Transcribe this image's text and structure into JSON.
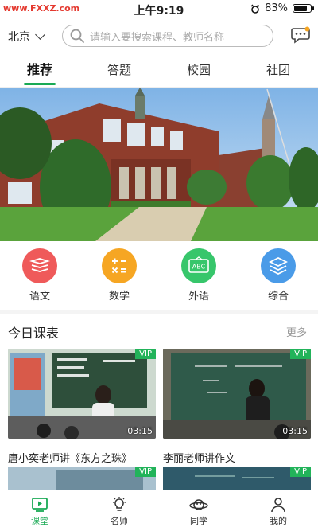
{
  "status_bar": {
    "watermark": "www.FXXZ.com",
    "time": "上午9:19",
    "battery": "83%",
    "battery_level": 0.83
  },
  "header": {
    "city": "北京",
    "search_placeholder": "请输入要搜索课程、教师名称"
  },
  "tabs": [
    {
      "label": "推荐",
      "active": true
    },
    {
      "label": "答题",
      "active": false
    },
    {
      "label": "校园",
      "active": false
    },
    {
      "label": "社团",
      "active": false
    }
  ],
  "categories": [
    {
      "label": "语文",
      "color": "#ef5a5a",
      "icon": "book-stack-icon"
    },
    {
      "label": "数学",
      "color": "#f6a623",
      "icon": "math-operators-icon"
    },
    {
      "label": "外语",
      "color": "#37c66b",
      "icon": "abc-board-icon"
    },
    {
      "label": "综合",
      "color": "#4a9be8",
      "icon": "layers-icon"
    }
  ],
  "schedule": {
    "title": "今日课表",
    "more": "更多",
    "courses": [
      {
        "title": "唐小奕老师讲《东方之珠》",
        "duration": "03:15",
        "badge": "VIP"
      },
      {
        "title": "李丽老师讲作文",
        "duration": "03:15",
        "badge": "VIP"
      },
      {
        "badge": "VIP"
      },
      {
        "badge": "VIP"
      }
    ]
  },
  "bottom_nav": [
    {
      "label": "课堂",
      "active": true
    },
    {
      "label": "名师",
      "active": false
    },
    {
      "label": "同学",
      "active": false
    },
    {
      "label": "我的",
      "active": false
    }
  ],
  "accent_color": "#1aaa55"
}
